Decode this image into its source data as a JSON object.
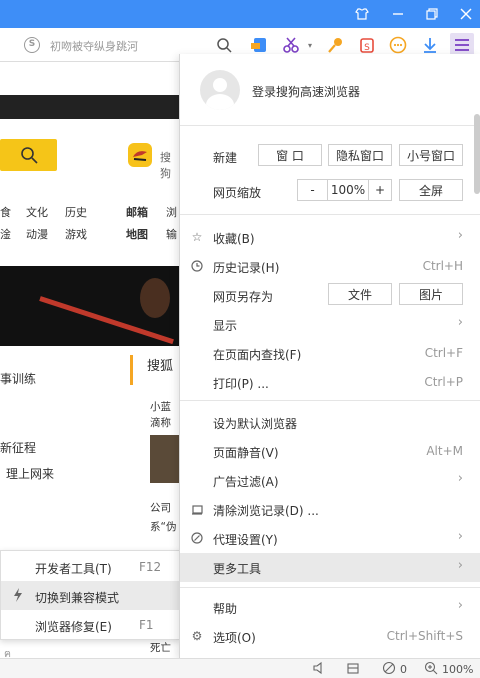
{
  "toolbar": {
    "address_placeholder": "初吻被夺纵身跳河",
    "icons": [
      "sogou-s-icon",
      "search-icon",
      "shield-icon",
      "scissors-icon",
      "key-icon",
      "recycle-icon",
      "smiley-icon",
      "download-icon",
      "menu-icon"
    ]
  },
  "page": {
    "nav_row1": [
      "食",
      "文化",
      "历史",
      "邮箱",
      "浏"
    ],
    "nav_row2": [
      "淦",
      "动漫",
      "游戏",
      "地图",
      "输"
    ],
    "sogou_partial": "搜狗",
    "sohu_head": "搜狐",
    "left_news": [
      "事训练",
      "新征程",
      "理上网来"
    ],
    "right_news": [
      "小蓝",
      "滴称",
      "公司",
      "系“伪",
      "死亡"
    ],
    "bottom_partial": "ฅ"
  },
  "submenu": {
    "items": [
      {
        "label": "开发者工具(T)",
        "shortcut": "F12"
      },
      {
        "label": "切换到兼容模式",
        "shortcut": ""
      },
      {
        "label": "浏览器修复(E)",
        "shortcut": "F1"
      }
    ]
  },
  "menu": {
    "login_text": "登录搜狗高速浏览器",
    "new_label": "新建",
    "new_buttons": [
      "窗 口",
      "隐私窗口",
      "小号窗口"
    ],
    "zoom_label": "网页缩放",
    "zoom_minus": "-",
    "zoom_value": "100%",
    "zoom_plus": "+",
    "fullscreen": "全屏",
    "items": [
      {
        "label": "收藏(B)",
        "shortcut": ""
      },
      {
        "label": "历史记录(H)",
        "shortcut": "Ctrl+H"
      },
      {
        "label": "网页另存为",
        "shortcut": ""
      },
      {
        "label": "显示",
        "shortcut": ""
      },
      {
        "label": "在页面内查找(F)",
        "shortcut": "Ctrl+F"
      },
      {
        "label": "打印(P) ...",
        "shortcut": "Ctrl+P"
      },
      {
        "label": "设为默认浏览器",
        "shortcut": ""
      },
      {
        "label": "页面静音(V)",
        "shortcut": "Alt+M"
      },
      {
        "label": "广告过滤(A)",
        "shortcut": ""
      },
      {
        "label": "清除浏览记录(D) ...",
        "shortcut": ""
      },
      {
        "label": "代理设置(Y)",
        "shortcut": ""
      },
      {
        "label": "更多工具",
        "shortcut": ""
      },
      {
        "label": "帮助",
        "shortcut": ""
      },
      {
        "label": "选项(O)",
        "shortcut": "Ctrl+Shift+S"
      }
    ],
    "save_buttons": [
      "文件",
      "图片"
    ]
  },
  "statusbar": {
    "ad_count": "0",
    "zoom": "100%"
  },
  "colors": {
    "titlebar": "#3e8ef7",
    "accent_yellow": "#f5c518"
  }
}
